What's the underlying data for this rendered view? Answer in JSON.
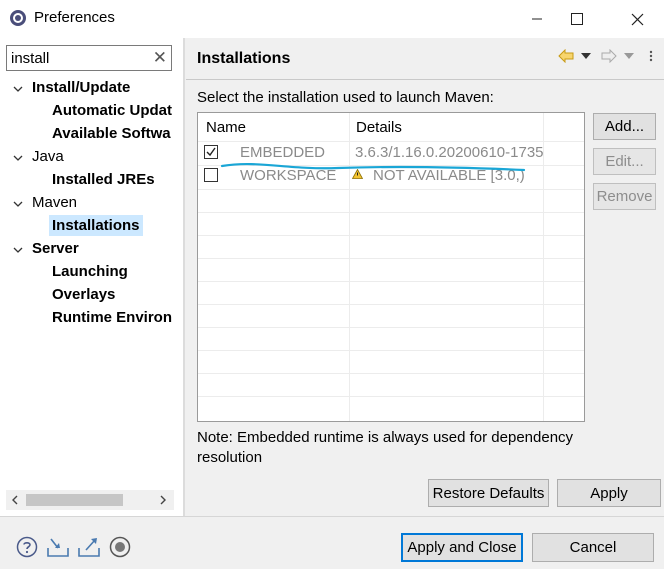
{
  "window": {
    "title": "Preferences",
    "icons": {
      "app": "eclipse-gear-icon",
      "minimize": "minimize-icon",
      "maximize": "maximize-icon",
      "close": "close-icon"
    }
  },
  "filter": {
    "value": "install",
    "clear_icon": "clear-x-icon"
  },
  "tree": {
    "items": [
      {
        "label": "Install/Update",
        "level": 0,
        "expanded": true,
        "bold": true
      },
      {
        "label": "Automatic Updat",
        "level": 1,
        "bold": true
      },
      {
        "label": "Available Softwa",
        "level": 1,
        "bold": true
      },
      {
        "label": "Java",
        "level": 0,
        "expanded": true,
        "bold": false
      },
      {
        "label": "Installed JREs",
        "level": 1,
        "bold": true
      },
      {
        "label": "Maven",
        "level": 0,
        "expanded": true,
        "bold": false
      },
      {
        "label": "Installations",
        "level": 1,
        "bold": true,
        "selected": true
      },
      {
        "label": "Server",
        "level": 0,
        "expanded": true,
        "bold": true
      },
      {
        "label": "Launching",
        "level": 1,
        "bold": true
      },
      {
        "label": "Overlays",
        "level": 1,
        "bold": true
      },
      {
        "label": "Runtime Environ",
        "level": 1,
        "bold": true
      }
    ]
  },
  "page": {
    "title": "Installations",
    "description": "Select the installation used to launch Maven:",
    "nav_icons": [
      "back-arrow-icon",
      "dropdown-icon",
      "forward-arrow-icon",
      "dropdown-icon",
      "view-menu-icon"
    ],
    "table": {
      "columns": [
        "Name",
        "Details"
      ],
      "rows": [
        {
          "checked": true,
          "name": "EMBEDDED",
          "details": "3.6.3/1.16.0.20200610-1735",
          "warning": false
        },
        {
          "checked": false,
          "name": "WORKSPACE",
          "details": "NOT AVAILABLE [3.0,)",
          "warning": true
        }
      ]
    },
    "buttons": {
      "add": "Add...",
      "edit": "Edit...",
      "remove": "Remove"
    },
    "note": "Note: Embedded runtime is always used for dependency resolution",
    "restore_defaults": "Restore Defaults",
    "apply": "Apply"
  },
  "footer": {
    "icons": [
      "help-icon",
      "import-icon",
      "export-icon",
      "record-icon"
    ],
    "apply_and_close": "Apply and Close",
    "cancel": "Cancel"
  },
  "colors": {
    "selection": "#cce8ff",
    "accent": "#0078d7",
    "annotation": "#1aa6d6"
  }
}
